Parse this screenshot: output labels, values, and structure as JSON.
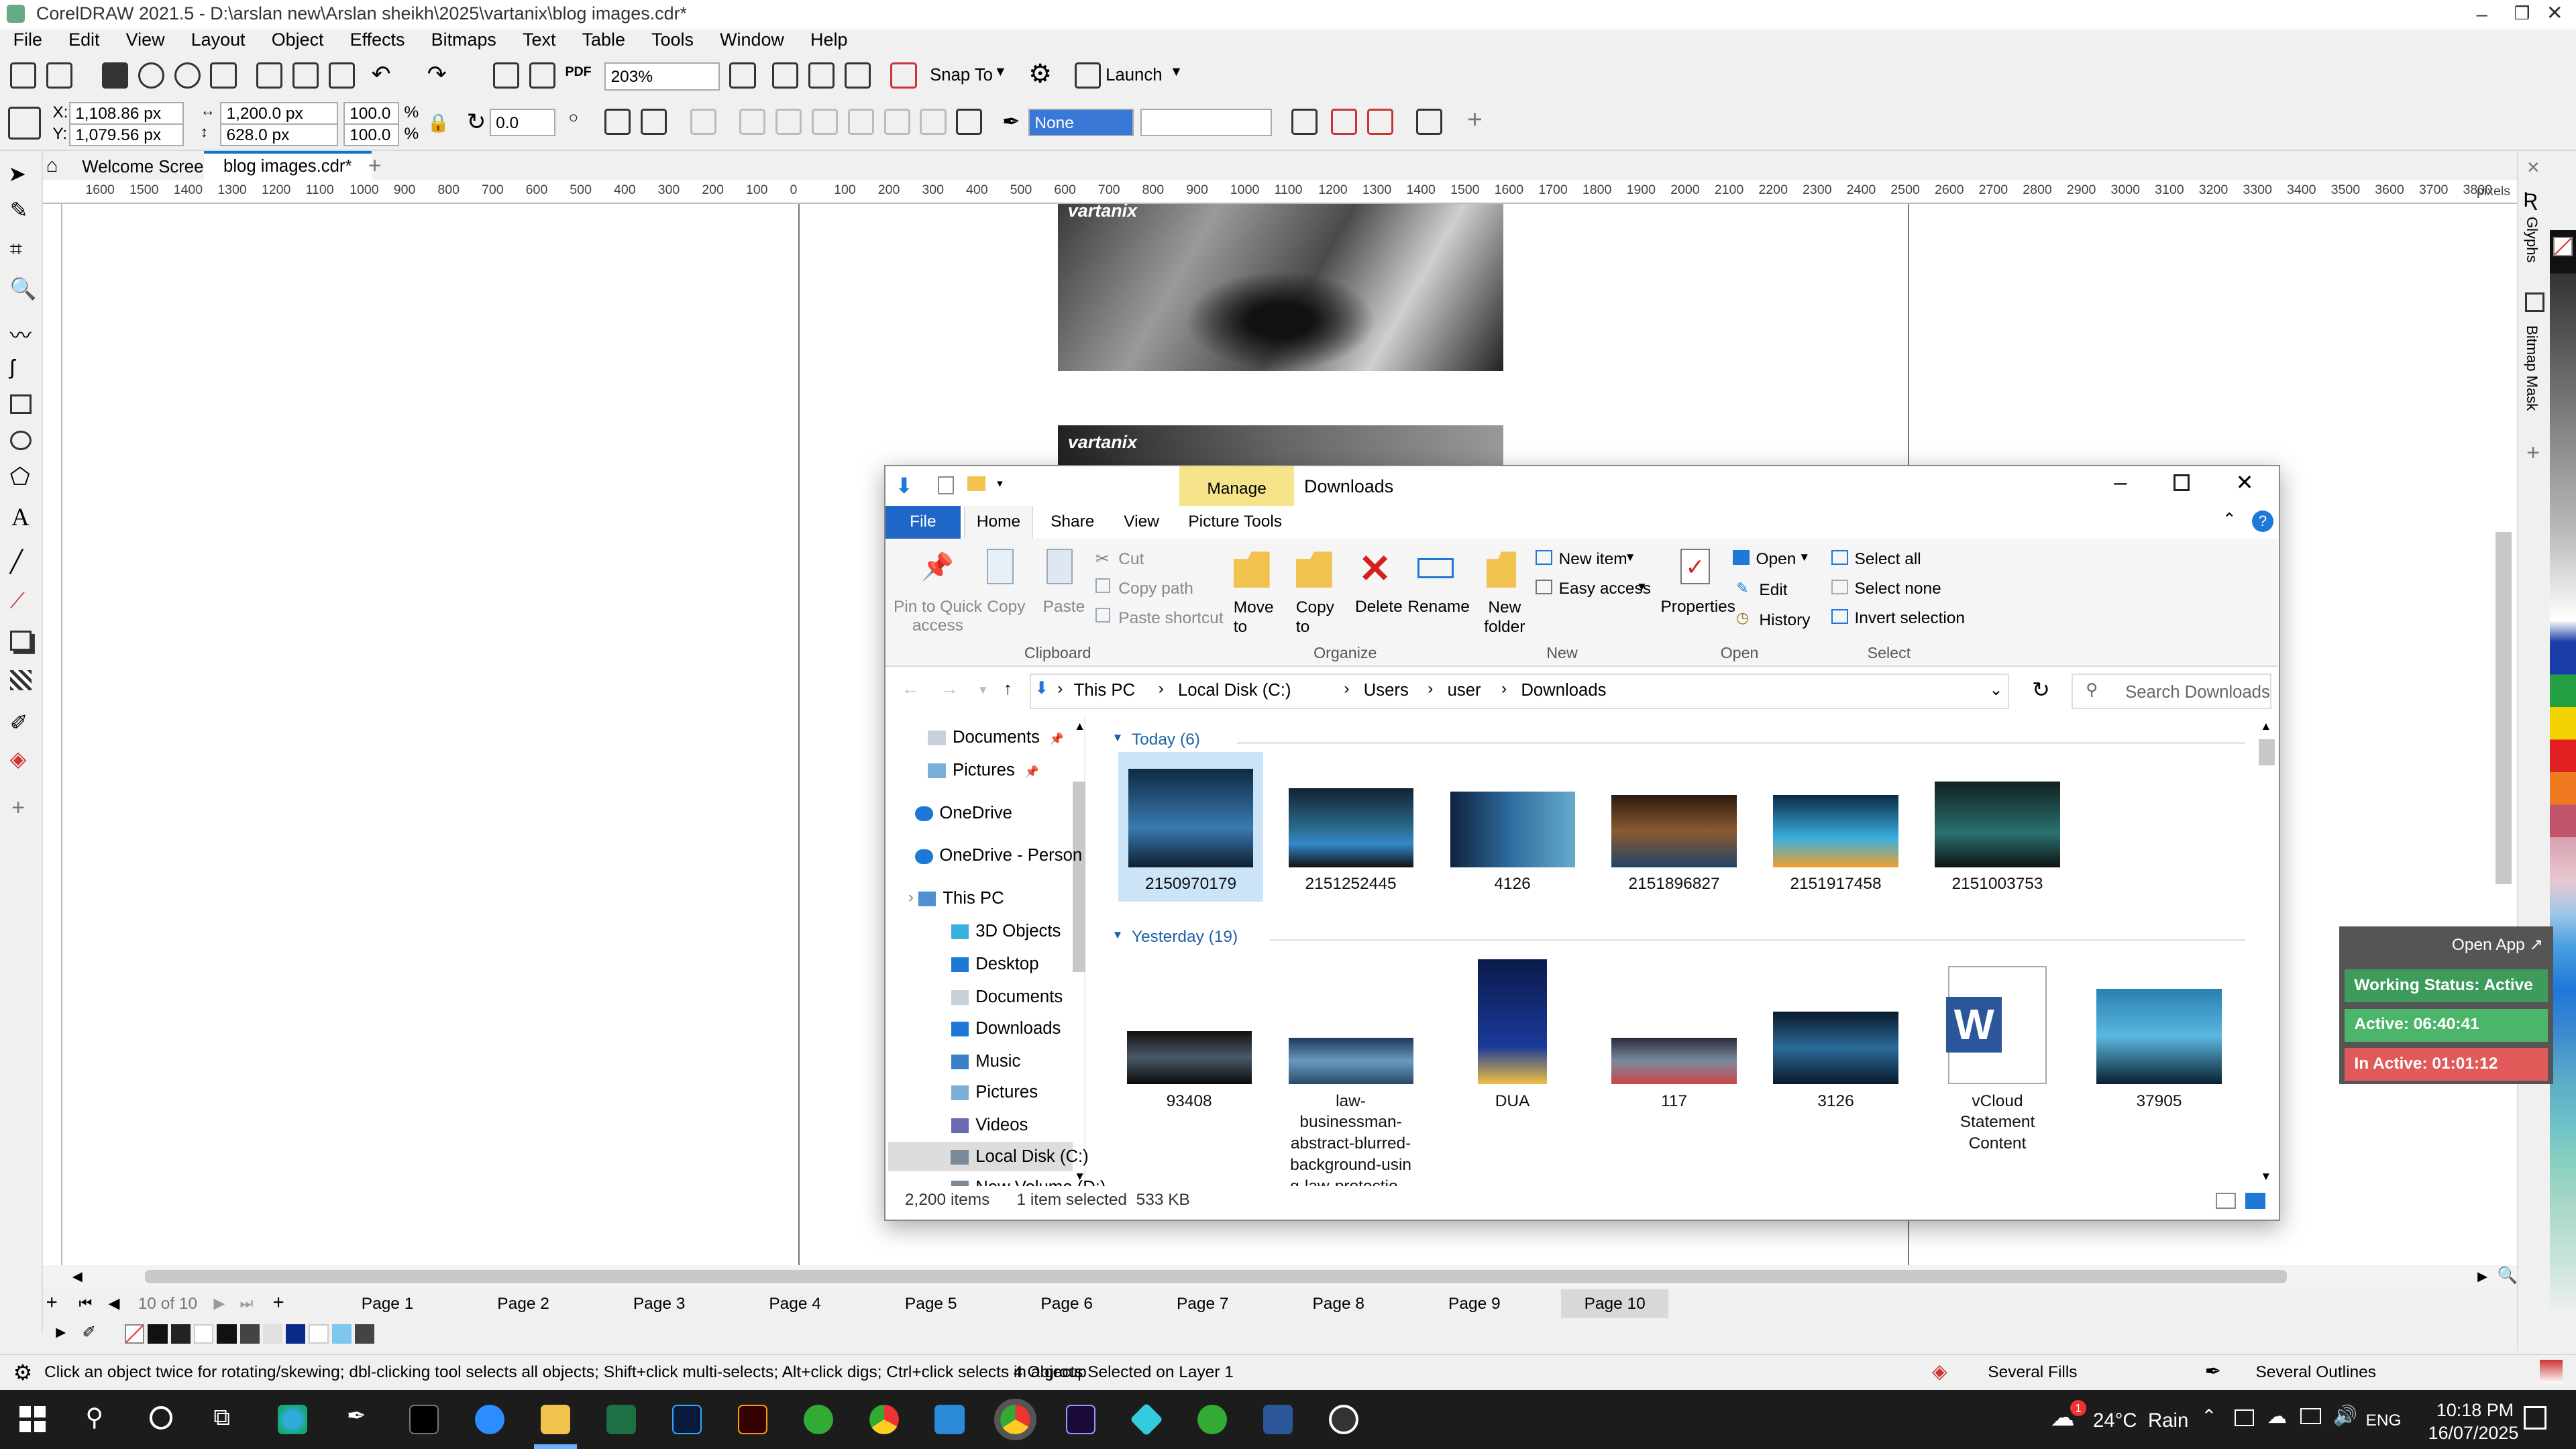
{
  "window": {
    "title": "CorelDRAW 2021.5 - D:\\arslan new\\Arslan sheikh\\2025\\vartanix\\blog images.cdr*"
  },
  "menu": [
    "File",
    "Edit",
    "View",
    "Layout",
    "Object",
    "Effects",
    "Bitmaps",
    "Text",
    "Table",
    "Tools",
    "Window",
    "Help"
  ],
  "toolbar": {
    "zoom": "203%",
    "snap_label": "Snap To",
    "launch_label": "Launch"
  },
  "props": {
    "x": "1,108.86 px",
    "y": "1,079.56 px",
    "w": "1,200.0 px",
    "h": "628.0 px",
    "sx": "100.0",
    "sy": "100.0",
    "pct": "%",
    "angle": "0.0",
    "outline": "None",
    "xl": "X:",
    "yl": "Y:"
  },
  "doc_tabs": {
    "welcome": "Welcome Screen",
    "doc": "blog images.cdr*"
  },
  "ruler": {
    "ticks": [
      "1600",
      "1500",
      "1400",
      "1300",
      "1200",
      "1100",
      "1000",
      "900",
      "800",
      "700",
      "600",
      "500",
      "400",
      "300",
      "200",
      "100",
      "0",
      "100",
      "200",
      "300",
      "400",
      "500",
      "600",
      "700",
      "800",
      "900",
      "1000",
      "1100",
      "1200",
      "1300",
      "1400",
      "1500",
      "1600",
      "1700",
      "1800",
      "1900",
      "2000",
      "2100",
      "2200",
      "2300",
      "2400",
      "2500",
      "2600",
      "2700",
      "2800",
      "2900",
      "3000",
      "3100",
      "3200",
      "3300",
      "3400",
      "3500",
      "3600",
      "3700",
      "3800"
    ],
    "unit": "pixels"
  },
  "canvas": {
    "logo1": "vartanix",
    "logo2": "vartanix"
  },
  "pager": {
    "counter": "10 of 10",
    "pages": [
      "Page 1",
      "Page 2",
      "Page 3",
      "Page 4",
      "Page 5",
      "Page 6",
      "Page 7",
      "Page 8",
      "Page 9",
      "Page 10"
    ]
  },
  "status": {
    "hint": "Click an object twice for rotating/skewing; dbl-clicking tool selects all objects; Shift+click multi-selects; Alt+click digs; Ctrl+click selects in a group",
    "selection": "4 Objects Selected on Layer 1",
    "fills": "Several Fills",
    "outlines": "Several Outlines"
  },
  "explorer": {
    "title": "Downloads",
    "manage": "Manage",
    "tabs": [
      "File",
      "Home",
      "Share",
      "View",
      "Picture Tools"
    ],
    "ribbon": {
      "pin": "Pin to Quick access",
      "copy": "Copy",
      "paste": "Paste",
      "cut": "Cut",
      "copy_path": "Copy path",
      "paste_shortcut": "Paste shortcut",
      "clipboard": "Clipboard",
      "move_to": "Move to",
      "copy_to": "Copy to",
      "delete": "Delete",
      "rename": "Rename",
      "organize": "Organize",
      "new_folder": "New folder",
      "new_item": "New item",
      "easy_access": "Easy access",
      "new": "New",
      "properties": "Properties",
      "open": "Open",
      "edit": "Edit",
      "history": "History",
      "open_group": "Open",
      "select_all": "Select all",
      "select_none": "Select none",
      "invert": "Invert selection",
      "select": "Select"
    },
    "path": [
      "This PC",
      "Local Disk (C:)",
      "Users",
      "user",
      "Downloads"
    ],
    "search_placeholder": "Search Downloads",
    "nav": [
      "Documents",
      "Pictures",
      "OneDrive",
      "OneDrive - Person",
      "This PC",
      "3D Objects",
      "Desktop",
      "Documents",
      "Downloads",
      "Music",
      "Pictures",
      "Videos",
      "Local Disk (C:)",
      "New Volume (D:)"
    ],
    "today": "Today (6)",
    "yesterday": "Yesterday (19)",
    "today_files": [
      "2150970179",
      "2151252445",
      "4126",
      "2151896827",
      "2151917458",
      "2151003753"
    ],
    "yesterday_files": [
      "93408",
      "law-businessman-abstract-blurred-background-usin g-law-protectio...",
      "DUA",
      "117",
      "3126",
      "vCloud Statement Content",
      "37905"
    ],
    "item_count": "2,200 items",
    "selected": "1 item selected  533 KB"
  },
  "widget": {
    "open_app": "Open App ↗",
    "working": "Working Status: Active",
    "active": "Active: 06:40:41",
    "inactive": "In Active: 01:01:12"
  },
  "taskbar": {
    "weather": "24°C  Rain",
    "lang": "ENG",
    "time": "10:18 PM",
    "date": "16/07/2025",
    "badge": "1"
  },
  "right_dock": {
    "glyphs": "Glyphs",
    "mask": "Bitmap Mask"
  },
  "colors": {
    "accent": "#0078d7",
    "ribbon_manage": "#f5e48a",
    "widget_green": "#4bb56a",
    "widget_red": "#e05a5a",
    "widget_status": "#3d9b5c"
  }
}
